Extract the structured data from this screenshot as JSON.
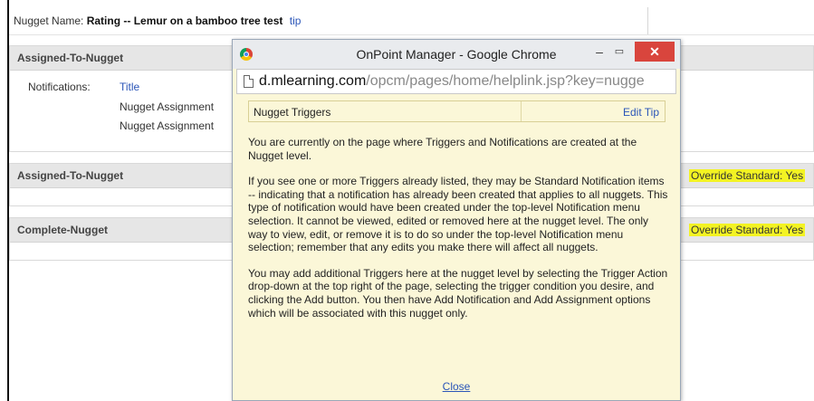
{
  "header": {
    "label": "Nugget Name:",
    "name": "Rating -- Lemur on a bamboo tree test",
    "tip": "tip"
  },
  "panels": [
    {
      "title": "Assigned-To-Nugget",
      "notifications_label": "Notifications:",
      "items": [
        "Title",
        "Nugget Assignment",
        "Nugget Assignment"
      ]
    },
    {
      "title": "Assigned-To-Nugget",
      "override": "Override Standard: Yes"
    },
    {
      "title": "Complete-Nugget",
      "override": "Override Standard: Yes"
    }
  ],
  "popup": {
    "window_title": "OnPoint Manager - Google Chrome",
    "min_label": "–",
    "max_label": "▭",
    "close_label": "✕",
    "url_host": "d.mlearning.com",
    "url_path": "/opcm/pages/home/helplink.jsp?key=nugge",
    "section_title": "Nugget Triggers",
    "edit_tip": "Edit Tip",
    "paragraphs": [
      "You are currently on the page where Triggers and Notifications are created at the Nugget level.",
      "If you see one or more Triggers already listed, they may be Standard Notification items -- indicating that a notification has already been created that applies to all nuggets. This type of notification would have been created under the top-level Notification menu selection. It cannot be viewed, edited or removed here at the nugget level. The only way to view, edit, or remove it is to do so under the top-level Notification menu selection; remember that any edits you make there will affect all nuggets.",
      "You may add additional Triggers here at the nugget level by selecting the Trigger Action drop-down at the top right of the page, selecting the trigger condition you desire, and clicking the Add button. You then have Add Notification and Add Assignment options which will be associated with this nugget only."
    ],
    "close_link": "Close"
  },
  "icons": {
    "browser": "chrome-icon",
    "page": "page-icon"
  },
  "colors": {
    "highlight": "#f3f323",
    "link": "#2a55b8",
    "popup_bg": "#fbf7d8",
    "close_button": "#d9453d"
  }
}
